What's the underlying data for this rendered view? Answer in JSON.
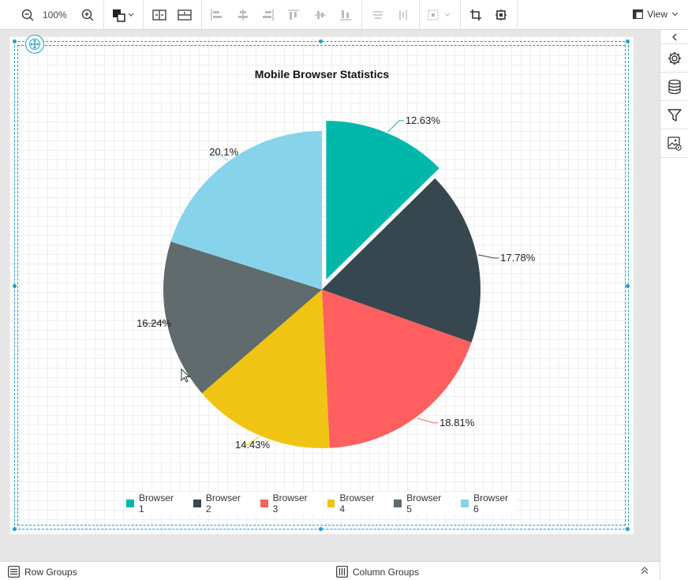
{
  "toolbar": {
    "zoom_level": "100%",
    "view_label": "View"
  },
  "bottom": {
    "row_groups": "Row Groups",
    "column_groups": "Column Groups"
  },
  "chart_data": {
    "type": "pie",
    "title": "Mobile Browser Statistics",
    "categories": [
      "Browser 1",
      "Browser 2",
      "Browser 3",
      "Browser 4",
      "Browser 5",
      "Browser 6"
    ],
    "values": [
      12.63,
      17.78,
      18.81,
      14.43,
      16.24,
      20.1
    ],
    "labels": [
      "12.63%",
      "17.78%",
      "18.81%",
      "14.43%",
      "16.24%",
      "20.1%"
    ],
    "colors": [
      "#00b8a9",
      "#37474f",
      "#ff5f5f",
      "#f0c413",
      "#5f6b6d",
      "#87d3eb"
    ],
    "exploded": [
      true,
      false,
      false,
      false,
      false,
      false
    ],
    "legend_position": "bottom"
  }
}
